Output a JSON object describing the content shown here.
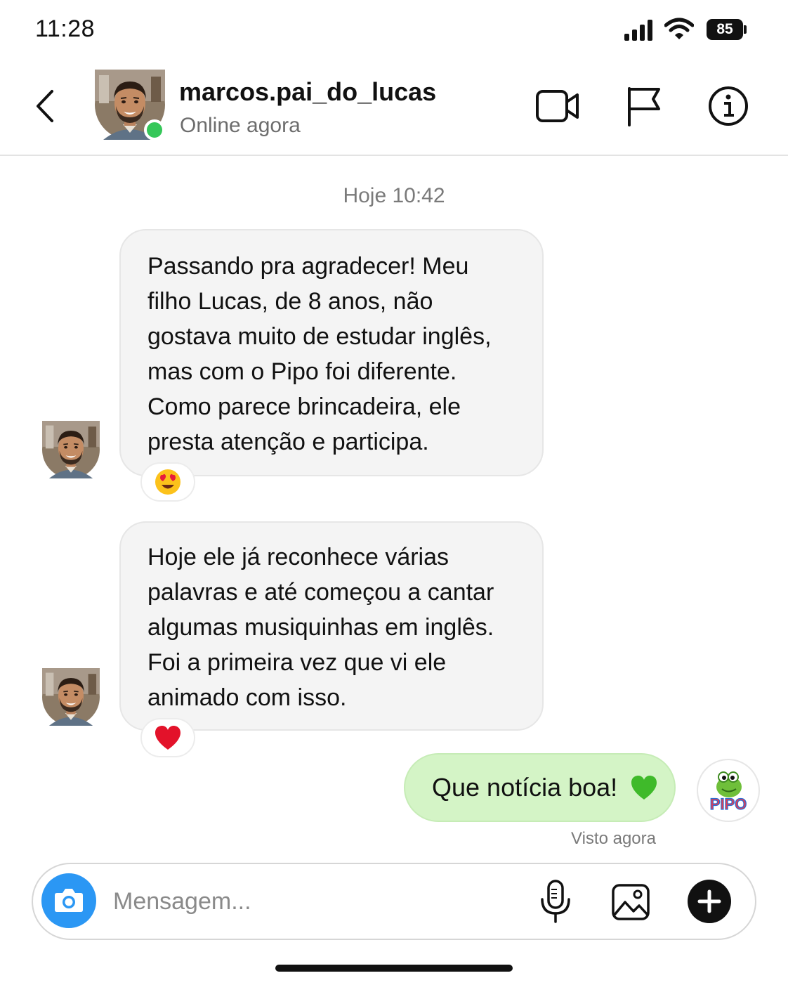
{
  "status_bar": {
    "time": "11:28",
    "battery": "85",
    "icons": [
      "signal-icon",
      "wifi-icon",
      "battery-icon"
    ]
  },
  "header": {
    "contact_name": "marcos.pai_do_lucas",
    "contact_status": "Online agora",
    "online_color": "#35c759",
    "icons": [
      "back-chevron-icon",
      "video-camera-icon",
      "flag-icon",
      "info-icon"
    ]
  },
  "chat": {
    "time_divider": "Hoje 10:42",
    "messages": [
      {
        "from": "contact",
        "text": "Passando pra agradecer! Meu\nfilho Lucas, de 8 anos, não\ngostava muito de estudar inglês,\nmas com o Pipo foi diferente.\nComo parece brincadeira, ele\npresta atenção e participa.",
        "reaction": "heart-eyes-emoji"
      },
      {
        "from": "contact",
        "text": "Hoje ele já reconhece várias\npalavras e até começou a cantar\nalgumas musiquinhas em inglês.\nFoi a primeira vez que vi ele\nanimado com isso.",
        "reaction": "red-heart-emoji"
      },
      {
        "from": "me",
        "text": "Que notícia boa!",
        "emoji": "green-heart-emoji"
      }
    ],
    "seen_label": "Visto agora",
    "pipo_logo_text": "PIPO"
  },
  "composer": {
    "placeholder": "Mensagem...",
    "value": "",
    "camera_color": "#2b97f4",
    "icons": [
      "camera-icon",
      "microphone-icon",
      "image-gallery-icon",
      "plus-icon"
    ]
  },
  "colors": {
    "incoming_bubble": "#f4f4f4",
    "outgoing_bubble": "#d4f4c6"
  }
}
